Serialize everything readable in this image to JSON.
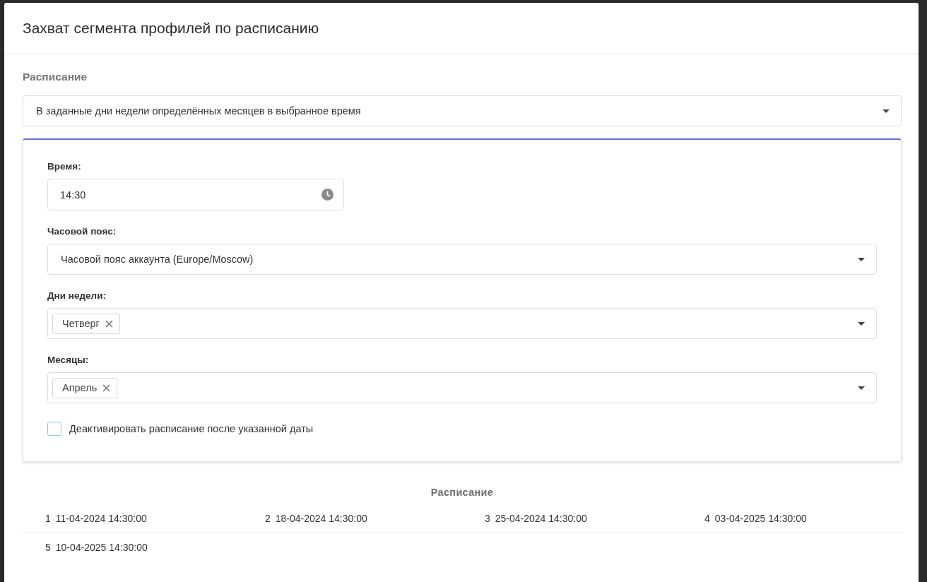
{
  "dialog": {
    "title": "Захват сегмента профилей по расписанию"
  },
  "schedule_type": {
    "label": "Расписание",
    "value": "В заданные дни недели определённых месяцев в выбранное время"
  },
  "settings_panel": {
    "time": {
      "label": "Время:",
      "value": "14:30"
    },
    "timezone": {
      "label": "Часовой пояс:",
      "value": "Часовой пояс аккаунта (Europe/Moscow)"
    },
    "weekdays": {
      "label": "Дни недели:",
      "tags": [
        "Четверг"
      ]
    },
    "months": {
      "label": "Месяцы:",
      "tags": [
        "Апрель"
      ]
    },
    "deactivate": {
      "label": "Деактивировать расписание после указанной даты",
      "checked": false
    }
  },
  "schedule_preview": {
    "title": "Расписание",
    "items": [
      {
        "number": "1",
        "datetime": "11-04-2024 14:30:00"
      },
      {
        "number": "2",
        "datetime": "18-04-2024 14:30:00"
      },
      {
        "number": "3",
        "datetime": "25-04-2024 14:30:00"
      },
      {
        "number": "4",
        "datetime": "03-04-2025 14:30:00"
      },
      {
        "number": "5",
        "datetime": "10-04-2025 14:30:00"
      }
    ]
  }
}
